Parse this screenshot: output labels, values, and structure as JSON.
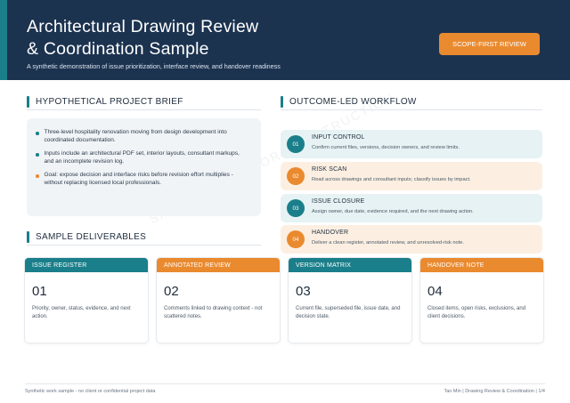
{
  "header": {
    "title_line1": "Architectural Drawing Review",
    "title_line2": "& Coordination Sample",
    "subtitle": "A synthetic demonstration of issue prioritization, interface review, and handover readiness",
    "scope_button": "SCOPE-FIRST REVIEW"
  },
  "brief": {
    "heading": "HYPOTHETICAL PROJECT BRIEF",
    "items": [
      {
        "text": "Three-level hospitality renovation moving from design development into coordinated documentation.",
        "color": "#1a7f8a"
      },
      {
        "text": "Inputs include an architectural PDF set, interior layouts, consultant markups, and an incomplete revision log.",
        "color": "#1a7f8a"
      },
      {
        "text": "Goal: expose decision and interface risks before revision effort multiplies - without replacing licensed local professionals.",
        "color": "#ea8a2f"
      }
    ]
  },
  "workflow": {
    "heading": "OUTCOME-LED WORKFLOW",
    "steps": [
      {
        "num": "01",
        "label": "INPUT CONTROL",
        "desc": "Confirm current files, versions, decision owners, and review limits.",
        "accent": "#1a7f8a",
        "bg": "#e6f2f3"
      },
      {
        "num": "02",
        "label": "RISK SCAN",
        "desc": "Read across drawings and consultant inputs; classify issues by impact.",
        "accent": "#ea8a2f",
        "bg": "#fcefe2"
      },
      {
        "num": "03",
        "label": "ISSUE CLOSURE",
        "desc": "Assign owner, due date, evidence required, and the next drawing action.",
        "accent": "#1a7f8a",
        "bg": "#e6f2f3"
      },
      {
        "num": "04",
        "label": "HANDOVER",
        "desc": "Deliver a clean register, annotated review, and unresolved-risk note.",
        "accent": "#ea8a2f",
        "bg": "#fcefe2"
      }
    ]
  },
  "deliverables": {
    "heading": "SAMPLE DELIVERABLES",
    "cards": [
      {
        "title": "ISSUE REGISTER",
        "num": "01",
        "desc": "Priority, owner, status, evidence, and next action.",
        "color": "#1a7f8a"
      },
      {
        "title": "ANNOTATED REVIEW",
        "num": "02",
        "desc": "Comments linked to drawing context - not scattered notes.",
        "color": "#ea8a2f"
      },
      {
        "title": "VERSION MATRIX",
        "num": "03",
        "desc": "Current file, superseded file, issue date, and decision state.",
        "color": "#1a7f8a"
      },
      {
        "title": "HANDOVER NOTE",
        "num": "04",
        "desc": "Closed items, open risks, exclusions, and client decisions.",
        "color": "#ea8a2f"
      }
    ]
  },
  "watermark": "SAMPLE - NOT FOR CONSTRUCTION",
  "footer": {
    "left": "Synthetic work sample - no client or confidential project data",
    "right": "Tao Min | Drawing Review & Coordination | 1/4"
  },
  "colors": {
    "navy": "#1c3350",
    "teal": "#1a7f8a",
    "orange": "#ea8a2f"
  }
}
